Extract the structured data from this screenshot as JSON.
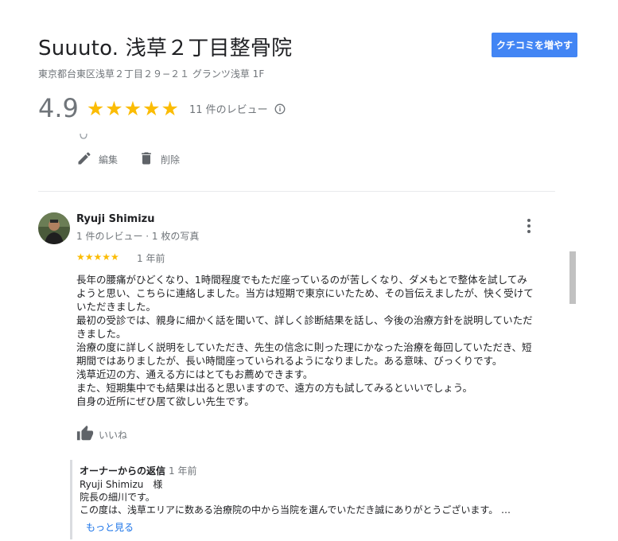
{
  "place": {
    "title": "Suuuto. 浅草２丁目整骨院",
    "address": "東京都台東区浅草２丁目２９−２１ グランツ浅草 1F",
    "add_review_label": "クチコミを増やす",
    "rating_value": "4.9",
    "rating_stars": "★★★★★",
    "review_count": "11 件のレビュー"
  },
  "actions": {
    "edit_label": "編集",
    "delete_label": "削除"
  },
  "review": {
    "reviewer_name": "Ryuji Shimizu",
    "reviewer_meta": "1 件のレビュー · 1 枚の写真",
    "stars": "★★★★★",
    "rating": 5,
    "time": "1 年前",
    "lines": [
      "長年の腰痛がひどくなり、1時間程度でもただ座っているのが苦しくなり、ダメもとで整体を試してみ",
      "ようと思い、こちらに連絡しました。当方は短期で東京にいたため、その旨伝えましたが、快く受けて",
      "いただきました。",
      "最初の受診では、親身に細かく話を聞いて、詳しく診断結果を話し、今後の治療方針を説明していただ",
      "きました。",
      "治療の度に詳しく説明をしていただき、先生の信念に則った理にかなった治療を毎回していただき、短",
      "期間ではありましたが、長い時間座っていられるようになりました。ある意味、びっくりです。",
      "浅草近辺の方、通える方にはとてもお薦めできます。",
      "また、短期集中でも結果は出ると思いますので、遠方の方も試してみるといいでしょう。",
      "自身の近所にぜひ居て欲しい先生です。"
    ],
    "like_label": "いいね"
  },
  "owner_reply": {
    "label": "オーナーからの返信",
    "time": "1 年前",
    "lines": [
      "Ryuji Shimizu　様",
      "院長の細川です。",
      "この度は、浅草エリアに数ある治療院の中から当院を選んでいただき誠にありがとうございます。 …"
    ],
    "more_label": "もっと見る"
  },
  "colors": {
    "star": "#fbbc04",
    "primary_button": "#4285f4",
    "link": "#1a73e8",
    "secondary_text": "#70757a"
  },
  "icons": [
    "edit-pencil-icon",
    "trash-icon",
    "info-icon",
    "more-vert-icon",
    "thumb-up-icon"
  ]
}
